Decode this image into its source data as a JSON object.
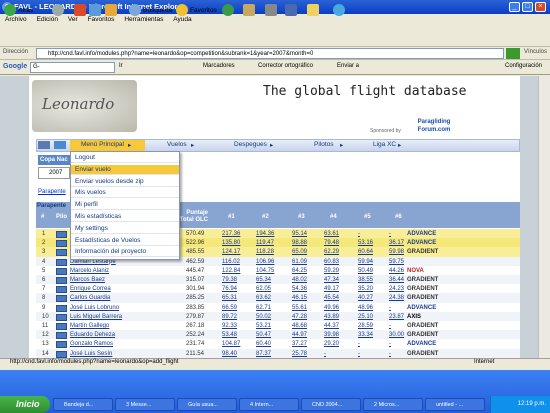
{
  "window": {
    "title": "FAVL - LEONARDO - Microsoft Internet Explorer"
  },
  "menubar": [
    "Archivo",
    "Edición",
    "Ver",
    "Favoritos",
    "Herramientas",
    "Ayuda"
  ],
  "toolbar": {
    "back": "Atrás",
    "search": "Búsqueda",
    "favorites": "Favoritos"
  },
  "address": {
    "label": "Dirección",
    "url": "http://cnd.favl.info/modules.php?name=leonardo&op=competition&subrank=1&year=2007&month=0",
    "go": "Ir",
    "links": "Vínculos"
  },
  "googlebar": {
    "label": "Google",
    "search_prefix": "G-",
    "go": "Ir",
    "bookmarks": "Marcadores",
    "spellcheck": "Corrector ortográfico",
    "send": "Enviar a",
    "settings": "Configuración"
  },
  "banner": {
    "logo": "Leonardo",
    "slogan": "The global flight database",
    "sponsored": "Sponsored by",
    "sponsor_name": "Paragliding Forum.com"
  },
  "nav": {
    "items": [
      "Menú Principal",
      "Vuelos",
      "Despegues",
      "Pilotos",
      "Liga XC"
    ]
  },
  "dropdown": {
    "items": [
      "Logout",
      "Enviar vuelo",
      "Enviar vuelos desde zip",
      "Mis vuelos",
      "Mi perfil",
      "Mis estadísticas",
      "My settings",
      "Estadísticas de Vuelos",
      "Información del proyecto"
    ],
    "highlighted": 1
  },
  "page": {
    "copa_label": "Copa Nac",
    "year": "2007",
    "parapente_link": "Parapente",
    "parapente_header": "Parapente",
    "col_num": "#",
    "col_pilot": "Pilo",
    "col_total": "Puntaje Total OLC",
    "col_scores": [
      "#1",
      "#2",
      "#3",
      "#4",
      "#5",
      "#6"
    ]
  },
  "table_rows": [
    {
      "n": "1",
      "name": "",
      "total": "570.49",
      "s": [
        "217.36",
        "194.36",
        "95.14",
        "63.61",
        "-",
        "-"
      ],
      "hl": true,
      "sponsor": "ADVANCE"
    },
    {
      "n": "2",
      "name": "",
      "total": "522.96",
      "s": [
        "135.80",
        "119.47",
        "98.88",
        "79.48",
        "53.16",
        "36.17"
      ],
      "hl": true,
      "sponsor": "ADVANCE"
    },
    {
      "n": "3",
      "name": "",
      "total": "485.55",
      "s": [
        "124.17",
        "118.28",
        "65.09",
        "62.29",
        "60.64",
        "59.98"
      ],
      "hl": true,
      "sponsor": "GRADIENT"
    },
    {
      "n": "4",
      "name": "Damián Lestarpe",
      "total": "462.59",
      "s": [
        "116.02",
        "106.96",
        "61.09",
        "60.83",
        "59.94",
        "59.75"
      ],
      "hl": false,
      "sponsor": ""
    },
    {
      "n": "5",
      "name": "Marcelo Alaniz",
      "total": "445.47",
      "s": [
        "122.84",
        "104.75",
        "64.25",
        "59.29",
        "50.49",
        "44.26"
      ],
      "hl": false,
      "sponsor": "NOVA"
    },
    {
      "n": "6",
      "name": "Marcos Baez",
      "total": "315.07",
      "s": [
        "79.38",
        "65.34",
        "48.02",
        "47.34",
        "38.55",
        "36.44"
      ],
      "hl": false,
      "sponsor": "GRADIENT"
    },
    {
      "n": "7",
      "name": "Enrique Correa",
      "total": "301.94",
      "s": [
        "76.94",
        "62.05",
        "54.36",
        "49.17",
        "35.20",
        "24.23"
      ],
      "hl": false,
      "sponsor": "GRADIENT"
    },
    {
      "n": "8",
      "name": "Carlos Guardia",
      "total": "285.25",
      "s": [
        "65.31",
        "63.62",
        "46.15",
        "45.54",
        "40.27",
        "24.38"
      ],
      "hl": false,
      "sponsor": "GRADIENT"
    },
    {
      "n": "9",
      "name": "José Luis Lobruno",
      "total": "283.85",
      "s": [
        "66.59",
        "62.71",
        "55.61",
        "49.96",
        "48.96",
        "-"
      ],
      "hl": false,
      "sponsor": "ADVANCE"
    },
    {
      "n": "10",
      "name": "Luis Miguel Barrera",
      "total": "279.87",
      "s": [
        "89.72",
        "50.02",
        "47.28",
        "43.89",
        "25.10",
        "23.87"
      ],
      "hl": false,
      "sponsor": "AXIS"
    },
    {
      "n": "11",
      "name": "Martín Gallego",
      "total": "267.18",
      "s": [
        "92.33",
        "53.21",
        "48.68",
        "44.37",
        "28.59",
        "-"
      ],
      "hl": false,
      "sponsor": "GRADIENT"
    },
    {
      "n": "12",
      "name": "Eduardo Deheza",
      "total": "252.24",
      "s": [
        "53.48",
        "50.47",
        "44.97",
        "39.98",
        "33.34",
        "30.00"
      ],
      "hl": false,
      "sponsor": "GRADIENT"
    },
    {
      "n": "13",
      "name": "Gonzalo Ramos",
      "total": "231.74",
      "s": [
        "104.87",
        "60.40",
        "37.27",
        "29.20",
        "-",
        "-"
      ],
      "hl": false,
      "sponsor": "ADVANCE"
    },
    {
      "n": "14",
      "name": "José Luis Sesín",
      "total": "211.54",
      "s": [
        "98.40",
        "87.37",
        "25.78",
        "-",
        "-",
        "-"
      ],
      "hl": false,
      "sponsor": "GRADIENT"
    }
  ],
  "status": {
    "url": "http://cnd.favl.info/modules.php?name=leonardo&op=add_flight",
    "zone": "Internet"
  },
  "taskbar": {
    "start": "Inicio",
    "tasks": [
      "Bandeja d...",
      "3 Messe...",
      "Guía usua...",
      "4 Intern...",
      "CND 2004...",
      "2 Micros...",
      "untitled - ..."
    ],
    "clock": "12:19 p.m."
  }
}
